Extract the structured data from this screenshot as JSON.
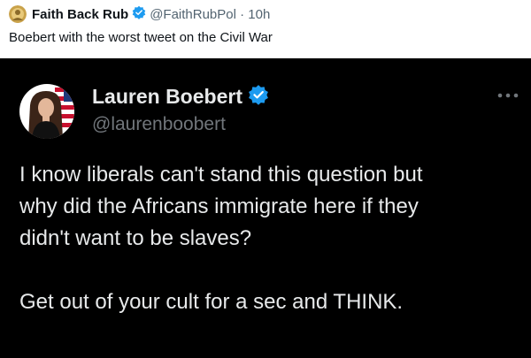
{
  "outer_post": {
    "author_name": "Faith Back Rub",
    "handle_time": "@FaithRubPol · 10h",
    "text": "Boebert with the worst tweet on the Civil War",
    "avatar_icon": "avatar-icon",
    "verified_icon": "verified-badge-icon"
  },
  "embedded_post": {
    "author_name": "Lauren Boebert",
    "handle": "@laurenboobert",
    "text": "I know liberals can't stand this question but\nwhy did the Africans immigrate here if they\ndidn't want to be slaves?\n\nGet out of your cult for a sec and THINK.",
    "more_icon": "more-options-icon",
    "verified_icon": "verified-badge-icon",
    "avatar_icon": "avatar-icon"
  },
  "colors": {
    "verified_blue": "#1d9bf0",
    "embed_background": "#000000",
    "outer_text": "#0f1419",
    "outer_secondary": "#536471",
    "inner_text": "#e7e9ea",
    "inner_secondary": "#71767b"
  }
}
